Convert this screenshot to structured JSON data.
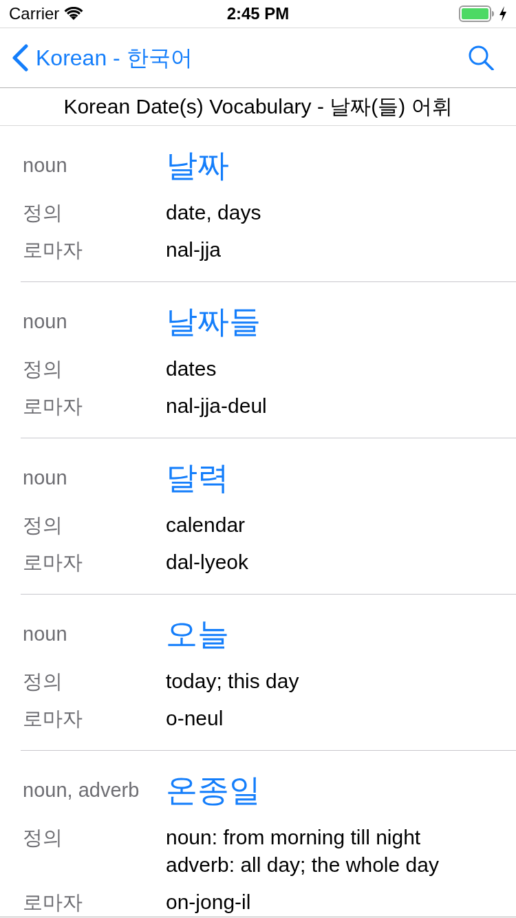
{
  "status_bar": {
    "carrier": "Carrier",
    "time": "2:45 PM"
  },
  "nav_bar": {
    "back_label": "Korean - 한국어"
  },
  "subtitle": "Korean Date(s) Vocabulary - 날짜(들) 어휘",
  "entries": [
    {
      "part_of_speech": "noun",
      "word": "날짜",
      "fields": [
        {
          "label": "정의",
          "value": "date, days"
        },
        {
          "label": "로마자",
          "value": "nal-jja"
        }
      ]
    },
    {
      "part_of_speech": "noun",
      "word": "날짜들",
      "fields": [
        {
          "label": "정의",
          "value": "dates"
        },
        {
          "label": "로마자",
          "value": "nal-jja-deul"
        }
      ]
    },
    {
      "part_of_speech": "noun",
      "word": "달력",
      "fields": [
        {
          "label": "정의",
          "value": "calendar"
        },
        {
          "label": "로마자",
          "value": "dal-lyeok"
        }
      ]
    },
    {
      "part_of_speech": "noun",
      "word": "오늘",
      "fields": [
        {
          "label": "정의",
          "value": "today; this day"
        },
        {
          "label": "로마자",
          "value": "o-neul"
        }
      ]
    },
    {
      "part_of_speech": "noun, adverb",
      "word": "온종일",
      "fields": [
        {
          "label": "정의",
          "value": "noun: from morning till night\nadverb: all day; the whole day"
        },
        {
          "label": "로마자",
          "value": "on-jong-il"
        }
      ]
    }
  ]
}
